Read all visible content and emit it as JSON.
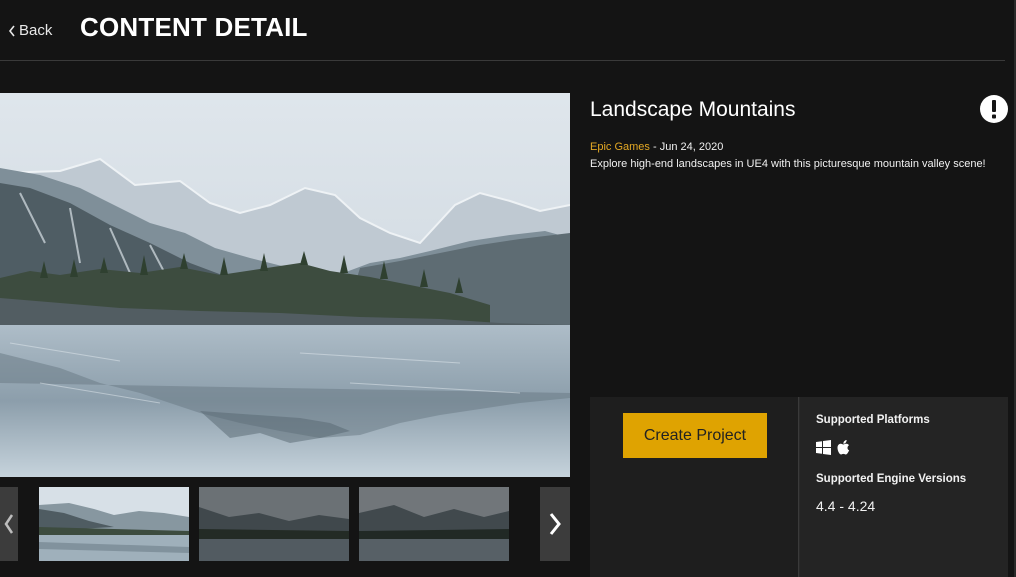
{
  "header": {
    "back_label": "Back",
    "title": "CONTENT DETAIL"
  },
  "product": {
    "title": "Landscape Mountains",
    "author": "Epic Games",
    "date_sep": " - ",
    "date": "Jun 24, 2020",
    "description": "Explore high-end landscapes in UE4 with this picturesque mountain valley scene!"
  },
  "actions": {
    "create_label": "Create Project"
  },
  "info": {
    "platforms_label": "Supported Platforms",
    "platforms": [
      "windows-icon",
      "apple-icon"
    ],
    "engine_label": "Supported Engine Versions",
    "engine_versions": "4.4 - 4.24"
  },
  "gallery": {
    "thumbnails": [
      "thumb-1",
      "thumb-2",
      "thumb-3"
    ],
    "selected_index": 0
  },
  "colors": {
    "accent": "#dfa301",
    "author": "#e3a824",
    "background": "#141414"
  }
}
